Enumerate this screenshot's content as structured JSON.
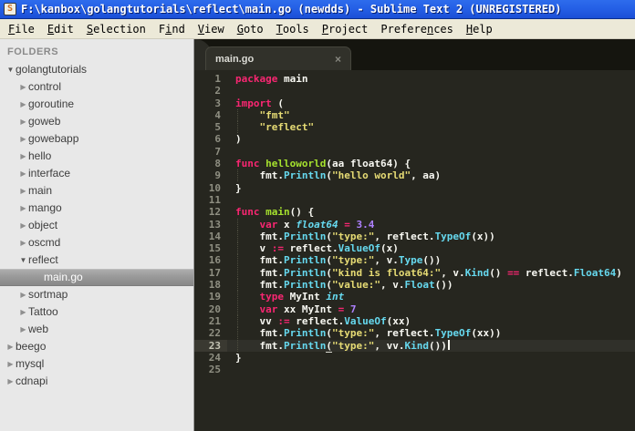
{
  "window": {
    "title": "F:\\kanbox\\golangtutorials\\reflect\\main.go (newdds) - Sublime Text 2 (UNREGISTERED)",
    "icon_letter": "S"
  },
  "menu": {
    "items": [
      {
        "pre": "",
        "u": "F",
        "post": "ile"
      },
      {
        "pre": "",
        "u": "E",
        "post": "dit"
      },
      {
        "pre": "",
        "u": "S",
        "post": "election"
      },
      {
        "pre": "F",
        "u": "i",
        "post": "nd"
      },
      {
        "pre": "",
        "u": "V",
        "post": "iew"
      },
      {
        "pre": "",
        "u": "G",
        "post": "oto"
      },
      {
        "pre": "",
        "u": "T",
        "post": "ools"
      },
      {
        "pre": "",
        "u": "P",
        "post": "roject"
      },
      {
        "pre": "Prefere",
        "u": "n",
        "post": "ces"
      },
      {
        "pre": "",
        "u": "H",
        "post": "elp"
      }
    ]
  },
  "sidebar": {
    "header": "FOLDERS",
    "items": [
      {
        "label": "golangtutorials",
        "level": 0,
        "state": "expanded",
        "selected": false
      },
      {
        "label": "control",
        "level": 1,
        "state": "collapsed",
        "selected": false
      },
      {
        "label": "goroutine",
        "level": 1,
        "state": "collapsed",
        "selected": false
      },
      {
        "label": "goweb",
        "level": 1,
        "state": "collapsed",
        "selected": false
      },
      {
        "label": "gowebapp",
        "level": 1,
        "state": "collapsed",
        "selected": false
      },
      {
        "label": "hello",
        "level": 1,
        "state": "collapsed",
        "selected": false
      },
      {
        "label": "interface",
        "level": 1,
        "state": "collapsed",
        "selected": false
      },
      {
        "label": "main",
        "level": 1,
        "state": "collapsed",
        "selected": false
      },
      {
        "label": "mango",
        "level": 1,
        "state": "collapsed",
        "selected": false
      },
      {
        "label": "object",
        "level": 1,
        "state": "collapsed",
        "selected": false
      },
      {
        "label": "oscmd",
        "level": 1,
        "state": "collapsed",
        "selected": false
      },
      {
        "label": "reflect",
        "level": 1,
        "state": "expanded",
        "selected": false
      },
      {
        "label": "main.go",
        "level": 2,
        "state": "file",
        "selected": true
      },
      {
        "label": "sortmap",
        "level": 1,
        "state": "collapsed",
        "selected": false
      },
      {
        "label": "Tattoo",
        "level": 1,
        "state": "collapsed",
        "selected": false
      },
      {
        "label": "web",
        "level": 1,
        "state": "collapsed",
        "selected": false
      },
      {
        "label": "beego",
        "level": 0,
        "state": "collapsed",
        "selected": false
      },
      {
        "label": "mysql",
        "level": 0,
        "state": "collapsed",
        "selected": false
      },
      {
        "label": "cdnapi",
        "level": 0,
        "state": "collapsed",
        "selected": false
      }
    ]
  },
  "tabs": [
    {
      "label": "main.go",
      "close": "×",
      "active": true
    }
  ],
  "editor": {
    "current_line": 23,
    "lines": [
      {
        "num": 1,
        "segs": [
          [
            "k",
            "package"
          ],
          [
            "p",
            " main"
          ]
        ]
      },
      {
        "num": 2,
        "segs": []
      },
      {
        "num": 3,
        "segs": [
          [
            "k",
            "import"
          ],
          [
            "p",
            " ("
          ]
        ]
      },
      {
        "num": 4,
        "segs": [
          [
            "i",
            ""
          ],
          [
            "s",
            "\"fmt\""
          ]
        ]
      },
      {
        "num": 5,
        "segs": [
          [
            "i",
            ""
          ],
          [
            "s",
            "\"reflect\""
          ]
        ]
      },
      {
        "num": 6,
        "segs": [
          [
            "p",
            ")"
          ]
        ]
      },
      {
        "num": 7,
        "segs": []
      },
      {
        "num": 8,
        "segs": [
          [
            "k",
            "func"
          ],
          [
            "p",
            " "
          ],
          [
            "f",
            "helloworld"
          ],
          [
            "p",
            "(aa float64) {"
          ]
        ]
      },
      {
        "num": 9,
        "segs": [
          [
            "i",
            ""
          ],
          [
            "p",
            "fmt."
          ],
          [
            "m",
            "Println"
          ],
          [
            "p",
            "("
          ],
          [
            "s",
            "\"hello world\""
          ],
          [
            "p",
            ", aa)"
          ]
        ]
      },
      {
        "num": 10,
        "segs": [
          [
            "p",
            "}"
          ]
        ]
      },
      {
        "num": 11,
        "segs": []
      },
      {
        "num": 12,
        "segs": [
          [
            "k",
            "func"
          ],
          [
            "p",
            " "
          ],
          [
            "f",
            "main"
          ],
          [
            "p",
            "() {"
          ]
        ]
      },
      {
        "num": 13,
        "segs": [
          [
            "i",
            ""
          ],
          [
            "k",
            "var"
          ],
          [
            "p",
            " x "
          ],
          [
            "t",
            "float64"
          ],
          [
            "p",
            " "
          ],
          [
            "k",
            "="
          ],
          [
            "p",
            " "
          ],
          [
            "n",
            "3.4"
          ]
        ]
      },
      {
        "num": 14,
        "segs": [
          [
            "i",
            ""
          ],
          [
            "p",
            "fmt."
          ],
          [
            "m",
            "Println"
          ],
          [
            "p",
            "("
          ],
          [
            "s",
            "\"type:\""
          ],
          [
            "p",
            ", reflect."
          ],
          [
            "m",
            "TypeOf"
          ],
          [
            "p",
            "(x))"
          ]
        ]
      },
      {
        "num": 15,
        "segs": [
          [
            "i",
            ""
          ],
          [
            "p",
            "v "
          ],
          [
            "k",
            ":="
          ],
          [
            "p",
            " reflect."
          ],
          [
            "m",
            "ValueOf"
          ],
          [
            "p",
            "(x)"
          ]
        ]
      },
      {
        "num": 16,
        "segs": [
          [
            "i",
            ""
          ],
          [
            "p",
            "fmt."
          ],
          [
            "m",
            "Println"
          ],
          [
            "p",
            "("
          ],
          [
            "s",
            "\"type:\""
          ],
          [
            "p",
            ", v."
          ],
          [
            "m",
            "Type"
          ],
          [
            "p",
            "())"
          ]
        ]
      },
      {
        "num": 17,
        "segs": [
          [
            "i",
            ""
          ],
          [
            "p",
            "fmt."
          ],
          [
            "m",
            "Println"
          ],
          [
            "p",
            "("
          ],
          [
            "s",
            "\"kind is float64:\""
          ],
          [
            "p",
            ", v."
          ],
          [
            "m",
            "Kind"
          ],
          [
            "p",
            "() "
          ],
          [
            "k",
            "=="
          ],
          [
            "p",
            " reflect."
          ],
          [
            "m",
            "Float64"
          ],
          [
            "p",
            ")"
          ]
        ]
      },
      {
        "num": 18,
        "segs": [
          [
            "i",
            ""
          ],
          [
            "p",
            "fmt."
          ],
          [
            "m",
            "Println"
          ],
          [
            "p",
            "("
          ],
          [
            "s",
            "\"value:\""
          ],
          [
            "p",
            ", v."
          ],
          [
            "m",
            "Float"
          ],
          [
            "p",
            "())"
          ]
        ]
      },
      {
        "num": 19,
        "segs": [
          [
            "i",
            ""
          ],
          [
            "k",
            "type"
          ],
          [
            "p",
            " MyInt "
          ],
          [
            "t",
            "int"
          ]
        ]
      },
      {
        "num": 20,
        "segs": [
          [
            "i",
            ""
          ],
          [
            "k",
            "var"
          ],
          [
            "p",
            " xx MyInt "
          ],
          [
            "k",
            "="
          ],
          [
            "p",
            " "
          ],
          [
            "n",
            "7"
          ]
        ]
      },
      {
        "num": 21,
        "segs": [
          [
            "i",
            ""
          ],
          [
            "p",
            "vv "
          ],
          [
            "k",
            ":="
          ],
          [
            "p",
            " reflect."
          ],
          [
            "m",
            "ValueOf"
          ],
          [
            "p",
            "(xx)"
          ]
        ]
      },
      {
        "num": 22,
        "segs": [
          [
            "i",
            ""
          ],
          [
            "p",
            "fmt."
          ],
          [
            "m",
            "Println"
          ],
          [
            "p",
            "("
          ],
          [
            "s",
            "\"type:\""
          ],
          [
            "p",
            ", reflect."
          ],
          [
            "m",
            "TypeOf"
          ],
          [
            "p",
            "(xx))"
          ]
        ]
      },
      {
        "num": 23,
        "segs": [
          [
            "i",
            ""
          ],
          [
            "p",
            "fmt."
          ],
          [
            "m",
            "Println"
          ],
          [
            "b",
            "("
          ],
          [
            "s",
            "\"type:\""
          ],
          [
            "p",
            ", vv."
          ],
          [
            "m",
            "Kind"
          ],
          [
            "p",
            "())"
          ],
          [
            "c",
            ""
          ]
        ]
      },
      {
        "num": 24,
        "segs": [
          [
            "p",
            "}"
          ]
        ]
      },
      {
        "num": 25,
        "segs": []
      }
    ]
  },
  "colors": {
    "titlebar_blue": "#2560e6",
    "menubar_bg": "#ece9d8",
    "sidebar_bg": "#e8e8e8",
    "sidebar_selection": "#999999",
    "editor_bg": "#26261f",
    "keyword_pink": "#f92672",
    "function_green": "#a6e22e",
    "type_cyan_italic": "#66d9ef",
    "support_cyan": "#66d9ef",
    "string_yellow": "#e6db74",
    "number_purple": "#ae81ff",
    "plain_text": "#f8f8f2",
    "gutter_gray": "#8f8f82"
  }
}
